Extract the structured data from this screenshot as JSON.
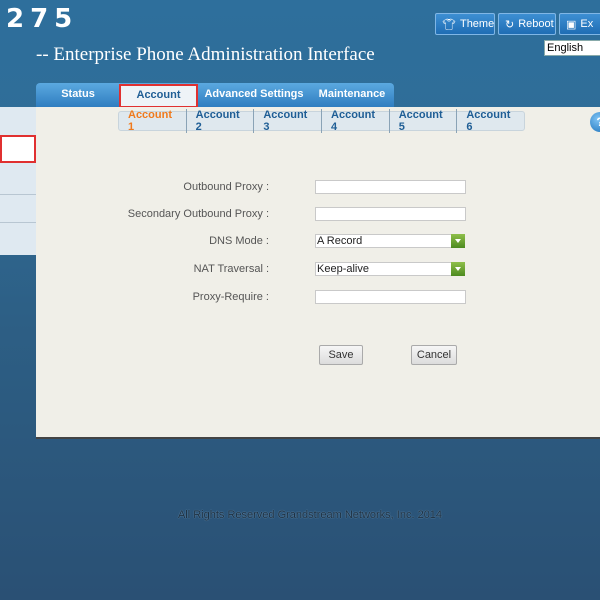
{
  "header": {
    "model": "275",
    "subtitle": "-- Enterprise Phone Administration Interface",
    "theme_label": "Theme",
    "reboot_label": "Reboot",
    "exit_label": "Ex",
    "language_value": "English"
  },
  "main_tabs": [
    "Status",
    "Account",
    "Advanced Settings",
    "Maintenance"
  ],
  "sub_tabs": [
    "Account 1",
    "Account 2",
    "Account 3",
    "Account 4",
    "Account 5",
    "Account 6"
  ],
  "form": {
    "outbound_proxy_label": "Outbound Proxy :",
    "outbound_proxy_value": "",
    "secondary_outbound_proxy_label": "Secondary Outbound Proxy :",
    "secondary_outbound_proxy_value": "",
    "dns_mode_label": "DNS Mode :",
    "dns_mode_value": "A Record",
    "nat_traversal_label": "NAT Traversal :",
    "nat_traversal_value": "Keep-alive",
    "proxy_require_label": "Proxy-Require :",
    "proxy_require_value": ""
  },
  "buttons": {
    "save": "Save",
    "cancel": "Cancel"
  },
  "footer": "All Rights Reserved Grandstream Networks, Inc. 2014",
  "colors": {
    "active_subtab": "#f07a1c",
    "highlight": "#e03030",
    "accent": "#1f6db4"
  },
  "icons": {
    "theme": "shirt-icon",
    "reboot": "reboot-icon",
    "exit": "exit-icon",
    "help": "help-icon",
    "dropdown": "chevron-down-icon"
  }
}
